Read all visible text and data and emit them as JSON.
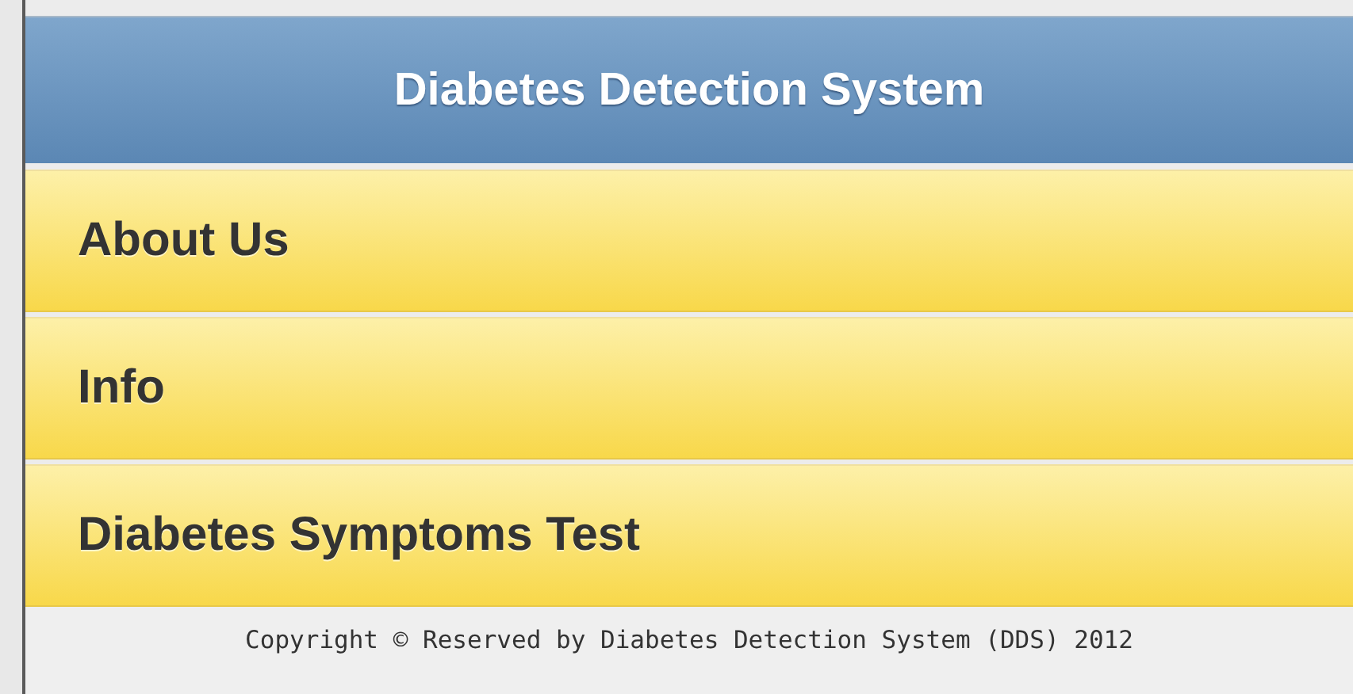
{
  "header": {
    "title": "Diabetes Detection System"
  },
  "menu": [
    {
      "label": "About Us"
    },
    {
      "label": "Info"
    },
    {
      "label": "Diabetes Symptoms Test"
    }
  ],
  "footer": {
    "text": "Copyright © Reserved by Diabetes Detection System (DDS) 2012"
  }
}
